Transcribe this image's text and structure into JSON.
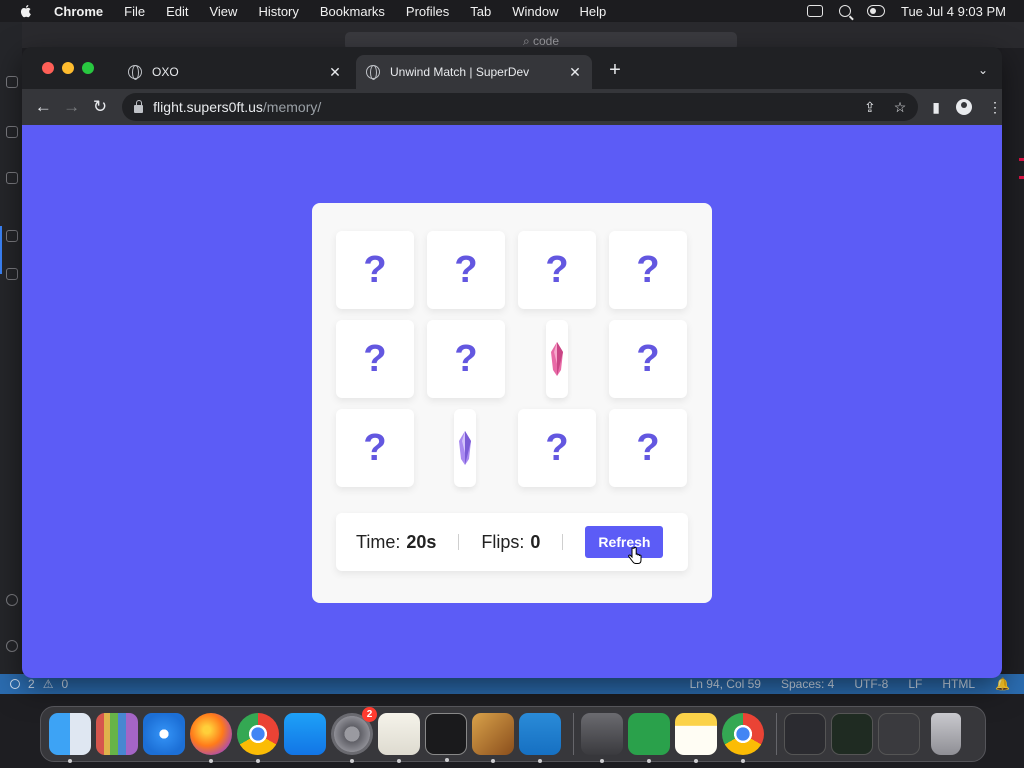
{
  "menubar": {
    "app_name": "Chrome",
    "items": [
      "File",
      "Edit",
      "View",
      "History",
      "Bookmarks",
      "Profiles",
      "Tab",
      "Window",
      "Help"
    ],
    "clock": "Tue Jul 4  9:03 PM"
  },
  "editor": {
    "search_text": "⌕ code",
    "status_left_errors": "2",
    "status_left_warnings": "0",
    "status_right": [
      "Ln 94, Col 59",
      "Spaces: 4",
      "UTF-8",
      "LF",
      "HTML"
    ]
  },
  "browser": {
    "tabs": [
      {
        "label": "OXO",
        "active": false
      },
      {
        "label": "Unwind Match | SuperDev",
        "active": true
      }
    ],
    "url_host": "flight.supers0ft.us",
    "url_path": "/memory/"
  },
  "game": {
    "hidden_symbol": "?",
    "cards": [
      {
        "state": "hidden"
      },
      {
        "state": "hidden"
      },
      {
        "state": "hidden"
      },
      {
        "state": "hidden"
      },
      {
        "state": "hidden"
      },
      {
        "state": "hidden"
      },
      {
        "state": "flipped",
        "gem": "pink-crystal"
      },
      {
        "state": "hidden"
      },
      {
        "state": "hidden"
      },
      {
        "state": "flipped",
        "gem": "purple-crystal"
      },
      {
        "state": "hidden"
      },
      {
        "state": "hidden"
      }
    ],
    "time_label": "Time:",
    "time_value": "20s",
    "flips_label": "Flips:",
    "flips_value": "0",
    "refresh_label": "Refresh"
  },
  "dock": {
    "settings_badge": "2",
    "apps": [
      "Finder",
      "Launchpad",
      "Safari",
      "Firefox",
      "Chrome",
      "App Store",
      "System Settings",
      "TextEdit",
      "Terminal",
      "GarageBand",
      "Visual Studio Code",
      "Calculator",
      "Numbers",
      "Notes",
      "Chrome",
      "Trash"
    ]
  },
  "colors": {
    "page_bg": "#5c5cf6",
    "question_mark": "#6357e0",
    "button_bg": "#5c5cf6"
  }
}
